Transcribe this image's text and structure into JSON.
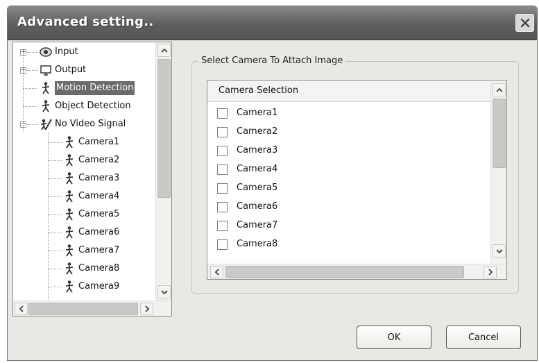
{
  "window": {
    "title": "Advanced setting.."
  },
  "tree": {
    "items": [
      {
        "label": "Input",
        "icon": "eye-icon",
        "expander": "+"
      },
      {
        "label": "Output",
        "icon": "monitor-icon",
        "expander": "+"
      },
      {
        "label": "Motion Detection",
        "icon": "person-icon",
        "selected": true
      },
      {
        "label": "Object Detection",
        "icon": "person-icon"
      },
      {
        "label": "No Video Signal",
        "icon": "no-signal-icon",
        "expander": "−"
      },
      {
        "label": "Camera1",
        "icon": "person-icon",
        "child": true
      },
      {
        "label": "Camera2",
        "icon": "person-icon",
        "child": true
      },
      {
        "label": "Camera3",
        "icon": "person-icon",
        "child": true
      },
      {
        "label": "Camera4",
        "icon": "person-icon",
        "child": true
      },
      {
        "label": "Camera5",
        "icon": "person-icon",
        "child": true
      },
      {
        "label": "Camera6",
        "icon": "person-icon",
        "child": true
      },
      {
        "label": "Camera7",
        "icon": "person-icon",
        "child": true
      },
      {
        "label": "Camera8",
        "icon": "person-icon",
        "child": true
      },
      {
        "label": "Camera9",
        "icon": "person-icon",
        "child": true
      }
    ]
  },
  "camera_panel": {
    "group_label": "Select Camera To Attach Image",
    "column_header": "Camera Selection",
    "cameras": [
      {
        "label": "Camera1",
        "checked": false
      },
      {
        "label": "Camera2",
        "checked": false
      },
      {
        "label": "Camera3",
        "checked": false
      },
      {
        "label": "Camera4",
        "checked": false
      },
      {
        "label": "Camera5",
        "checked": false
      },
      {
        "label": "Camera6",
        "checked": false
      },
      {
        "label": "Camera7",
        "checked": false
      },
      {
        "label": "Camera8",
        "checked": false
      }
    ]
  },
  "buttons": {
    "ok": "OK",
    "cancel": "Cancel"
  }
}
